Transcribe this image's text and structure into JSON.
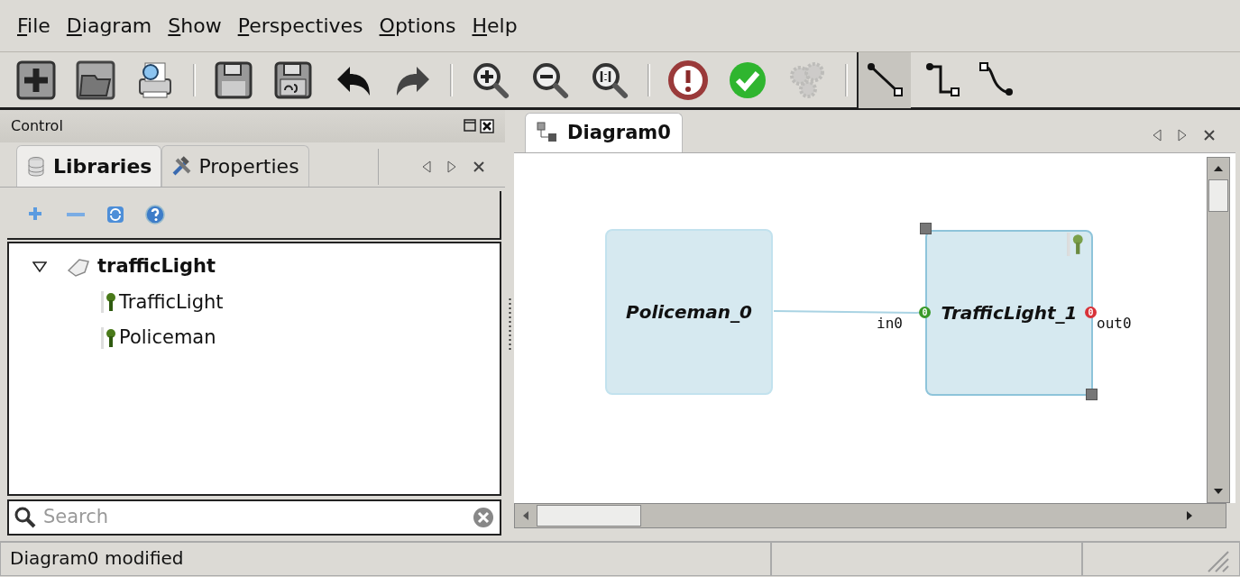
{
  "menu": [
    {
      "label": "File"
    },
    {
      "label": "Diagram"
    },
    {
      "label": "Show"
    },
    {
      "label": "Perspectives"
    },
    {
      "label": "Options"
    },
    {
      "label": "Help"
    }
  ],
  "toolbar": {
    "buttons": [
      {
        "disabled": false
      },
      {
        "disabled": false
      },
      {
        "disabled": false
      },
      {
        "disabled": false
      },
      {
        "disabled": false
      },
      {
        "disabled": false
      },
      {
        "disabled": false
      },
      {
        "disabled": false
      },
      {
        "disabled": false
      },
      {
        "disabled": false
      },
      {
        "disabled": false
      },
      {
        "disabled": false
      },
      {
        "disabled": true
      }
    ],
    "connector_styles": [
      {
        "selected": true
      },
      {
        "selected": false
      },
      {
        "selected": false
      }
    ]
  },
  "control_panel": {
    "title": "Control",
    "tabs": [
      {
        "label": "Libraries",
        "selected": true
      },
      {
        "label": "Properties",
        "selected": false
      }
    ],
    "tree": [
      {
        "label": "trafficLight",
        "expanded": true,
        "children": [
          {
            "label": "TrafficLight"
          },
          {
            "label": "Policeman"
          }
        ]
      }
    ],
    "search": {
      "placeholder": "Search"
    }
  },
  "diagram_panel": {
    "tabs": [
      {
        "label": "Diagram0",
        "selected": true
      }
    ],
    "nodes": [
      {
        "label": "Policeman_0",
        "selected": false
      },
      {
        "label": "TrafficLight_1",
        "selected": true,
        "ports": [
          {
            "name": "in0",
            "kind": "input",
            "mark": "0",
            "color": "#3a9a2a"
          },
          {
            "name": "out0",
            "kind": "output",
            "mark": "0",
            "color": "#d8333a"
          }
        ]
      }
    ]
  },
  "status_bar": [
    "Diagram0 modified"
  ]
}
